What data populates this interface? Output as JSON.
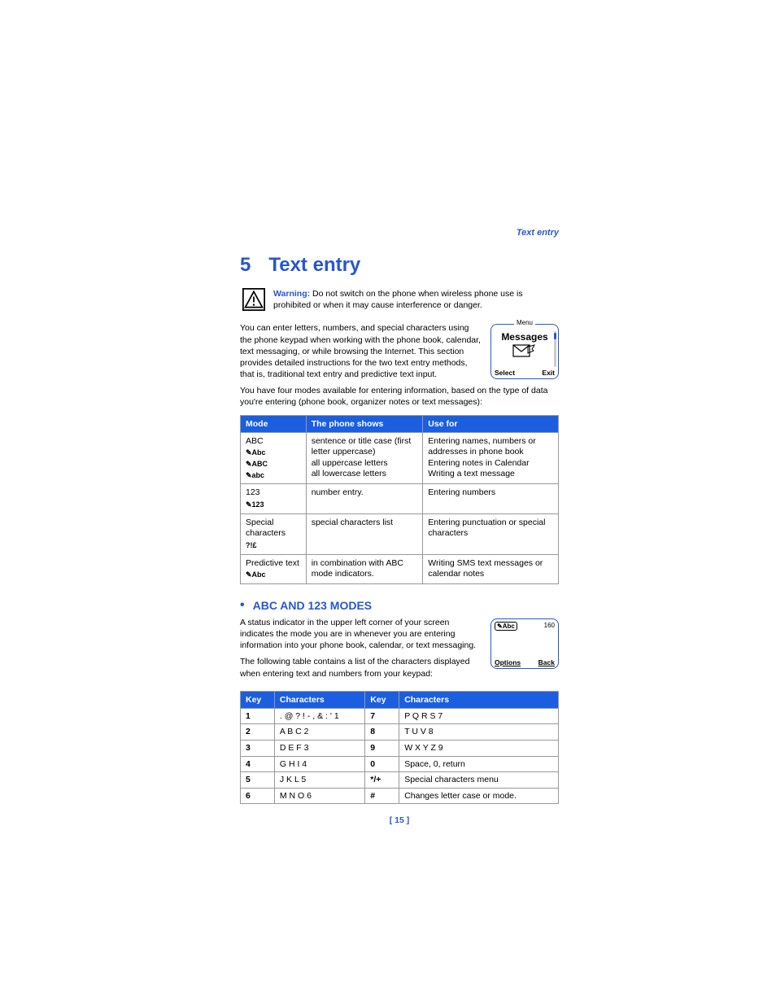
{
  "runningHeader": "Text entry",
  "chapter": {
    "number": "5",
    "title": "Text entry"
  },
  "warning": {
    "label": "Warning:",
    "text": "Do not switch on the phone when wireless phone use is prohibited or when it may cause interference or danger."
  },
  "intro1": "You can enter letters, numbers, and special characters using the phone keypad when working with the phone book, calendar, text messaging, or while browsing the Internet. This section provides detailed instructions for the two text entry methods, that is, traditional text entry and predictive text input.",
  "intro2": "You have four modes available for entering information, based on the type of data you're entering (phone book, organizer notes or text messages):",
  "phoneMenu": {
    "topLabel": "Menu",
    "title": "Messages",
    "left": "Select",
    "right": "Exit"
  },
  "modesTable": {
    "headers": [
      "Mode",
      "The phone shows",
      "Use for"
    ],
    "rows": [
      {
        "modeLabel": "ABC",
        "icons": [
          "✎Abc",
          "✎ABC",
          "✎abc"
        ],
        "shows": "sentence or title case (first letter uppercase)\nall uppercase letters\nall lowercase letters",
        "use": "Entering names, numbers or addresses in phone book\nEntering notes in Calendar\nWriting a text message"
      },
      {
        "modeLabel": "123",
        "icons": [
          "✎123"
        ],
        "shows": "number entry.",
        "use": "Entering numbers"
      },
      {
        "modeLabel": "Special characters",
        "icons": [
          "?!£"
        ],
        "shows": "special characters list",
        "use": "Entering punctuation or special characters"
      },
      {
        "modeLabel": "Predictive text",
        "icons": [
          "✎Abc"
        ],
        "shows": "in combination with ABC mode indicators.",
        "use": "Writing SMS text messages or calendar notes"
      }
    ]
  },
  "section2": {
    "title": "ABC AND 123 MODES",
    "p1": "A status indicator in the upper left corner of your screen indicates the mode you are in whenever you are entering information into your phone book, calendar, or text messaging.",
    "p2": "The following table contains a list of the characters displayed when entering text and numbers from your keypad:"
  },
  "phoneScreen2": {
    "topLeft": "✎Abc",
    "topRight": "160",
    "left": "Options",
    "right": "Back"
  },
  "keysTable": {
    "headers": [
      "Key",
      "Characters",
      "Key",
      "Characters"
    ],
    "rows": [
      [
        "1",
        ". @ ? ! - , & : ' 1",
        "7",
        "P Q R S 7"
      ],
      [
        "2",
        "A B C 2",
        "8",
        "T U V 8"
      ],
      [
        "3",
        "D E F 3",
        "9",
        "W X Y Z 9"
      ],
      [
        "4",
        "G H I 4",
        "0",
        "Space, 0, return"
      ],
      [
        "5",
        "J K L 5",
        "*/+",
        "Special characters menu"
      ],
      [
        "6",
        "M N O 6",
        "#",
        "Changes letter case or mode."
      ]
    ]
  },
  "pageNumber": "[ 15 ]"
}
